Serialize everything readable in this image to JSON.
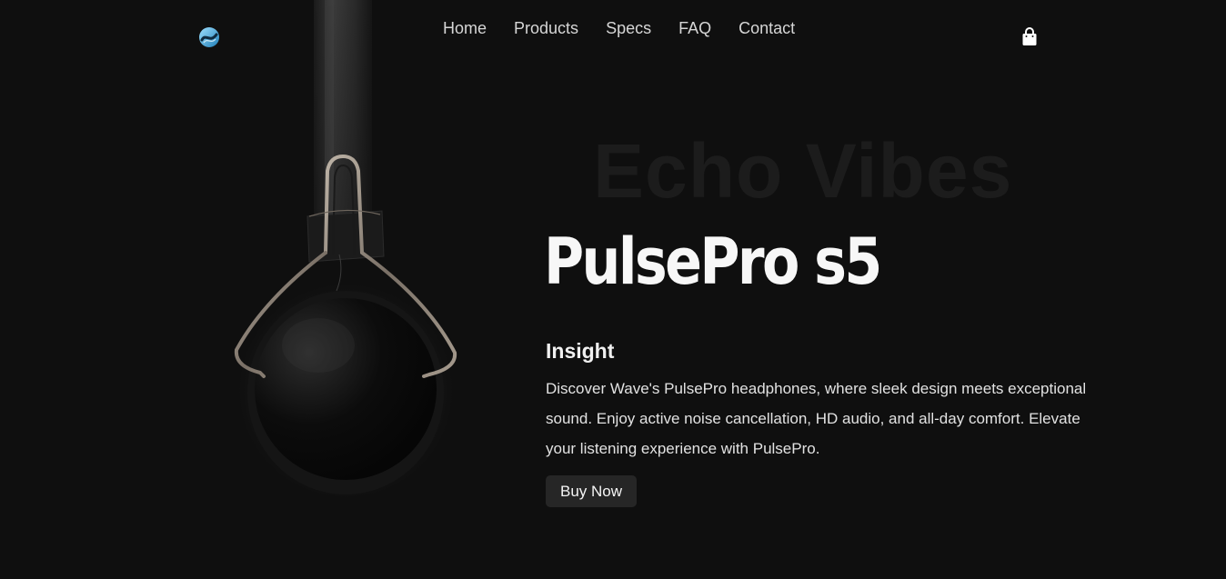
{
  "nav": {
    "logo_icon": "wave-logo-icon",
    "items": [
      "Home",
      "Products",
      "Specs",
      "FAQ",
      "Contact"
    ],
    "cart_icon": "shopping-bag-icon"
  },
  "hero": {
    "background_title": "Echo Vibes",
    "product_title": "PulsePro s5",
    "subtitle": "Insight",
    "description": "Discover Wave's PulsePro headphones, where sleek design meets exceptional sound. Enjoy active noise cancellation, HD audio, and all-day comfort. Elevate your listening experience with PulsePro.",
    "cta_label": "Buy Now",
    "product_image": "headphone-image"
  },
  "colors": {
    "background": "#0f0f0f",
    "text": "#e9e9e9",
    "button_bg": "#262626",
    "logo_accent": "#4fb3e0"
  }
}
